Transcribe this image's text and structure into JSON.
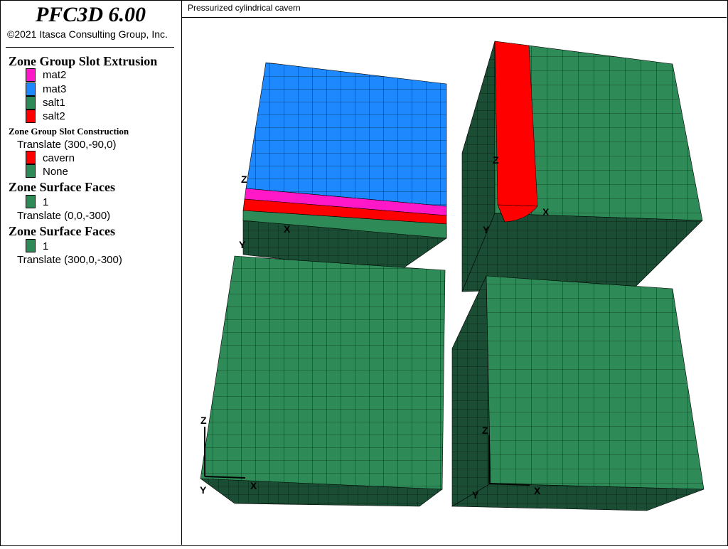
{
  "app": {
    "title": "PFC3D 6.00",
    "copyright": "©2021 Itasca Consulting Group, Inc."
  },
  "legend": {
    "extrusion": {
      "title": "Zone Group Slot Extrusion",
      "items": [
        {
          "label": "mat2",
          "color": "#ff18c8"
        },
        {
          "label": "mat3",
          "color": "#1e88ff"
        },
        {
          "label": "salt1",
          "color": "#2e8b57"
        },
        {
          "label": "salt2",
          "color": "#ff0000"
        }
      ]
    },
    "construction": {
      "title": "Zone Group Slot Construction",
      "translate": "Translate (300,-90,0)",
      "items": [
        {
          "label": "cavern",
          "color": "#ff0000"
        },
        {
          "label": "None",
          "color": "#2e8b57"
        }
      ]
    },
    "surface1": {
      "title": "Zone Surface Faces",
      "items": [
        {
          "label": "1",
          "color": "#2e8b57"
        }
      ],
      "translate": "Translate (0,0,-300)"
    },
    "surface2": {
      "title": "Zone Surface Faces",
      "items": [
        {
          "label": "1",
          "color": "#2e8b57"
        }
      ],
      "translate": "Translate (300,0,-300)"
    }
  },
  "view": {
    "title": "Pressurized cylindrical cavern",
    "axes": {
      "x": "X",
      "y": "Y",
      "z": "Z"
    }
  },
  "colors": {
    "mesh_face": "#2e8b57",
    "mesh_side": "#1a4d33",
    "mesh_line": "#000000",
    "mat2": "#ff18c8",
    "mat3": "#1e88ff",
    "salt2": "#ff0000"
  }
}
